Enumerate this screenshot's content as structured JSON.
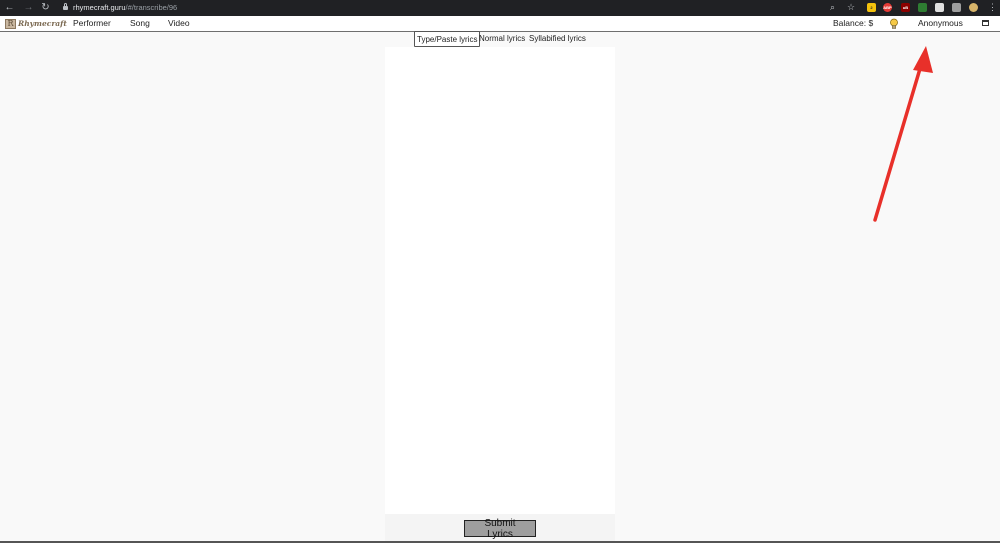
{
  "browser": {
    "url_host": "rhymecraft.guru",
    "url_path": "/#/transcribe/96",
    "extensions": [
      {
        "name": "sticky-note-extension",
        "color": "#f4c20d",
        "label": "2"
      },
      {
        "name": "adblock-plus-extension",
        "color": "#e53935",
        "label": "ABP"
      },
      {
        "name": "ublock-extension",
        "color": "#8b0000",
        "label": "uB"
      }
    ]
  },
  "app": {
    "logo_text": "Rhymecraft",
    "menu": [
      {
        "label": "Performer"
      },
      {
        "label": "Song"
      },
      {
        "label": "Video"
      }
    ],
    "balance_label": "Balance: $",
    "user_label": "Anonymous"
  },
  "editor": {
    "tabs": [
      {
        "label": "Type/Paste lyrics",
        "active": true
      },
      {
        "label": "Normal lyrics",
        "active": false
      },
      {
        "label": "Syllabified lyrics",
        "active": false
      }
    ],
    "lyrics_value": "",
    "submit_label": "Submit Lyrics"
  },
  "annotation": {
    "arrow_color": "#e8302a"
  }
}
